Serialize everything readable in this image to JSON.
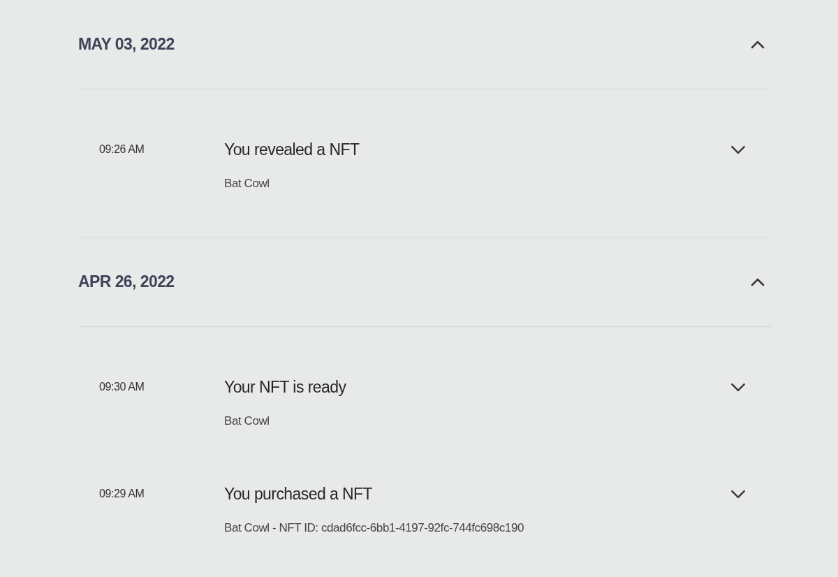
{
  "groups": [
    {
      "date": "MAY 03, 2022",
      "expanded": true,
      "entries": [
        {
          "time": "09:26 AM",
          "title": "You revealed a NFT",
          "detail": "Bat Cowl",
          "expanded": false
        }
      ]
    },
    {
      "date": "APR 26, 2022",
      "expanded": true,
      "entries": [
        {
          "time": "09:30 AM",
          "title": "Your NFT is ready",
          "detail": "Bat Cowl",
          "expanded": false
        },
        {
          "time": "09:29 AM",
          "title": "You purchased a NFT",
          "detail": "Bat Cowl - NFT ID: cdad6fcc-6bb1-4197-92fc-744fc698c190",
          "expanded": false
        }
      ]
    }
  ]
}
